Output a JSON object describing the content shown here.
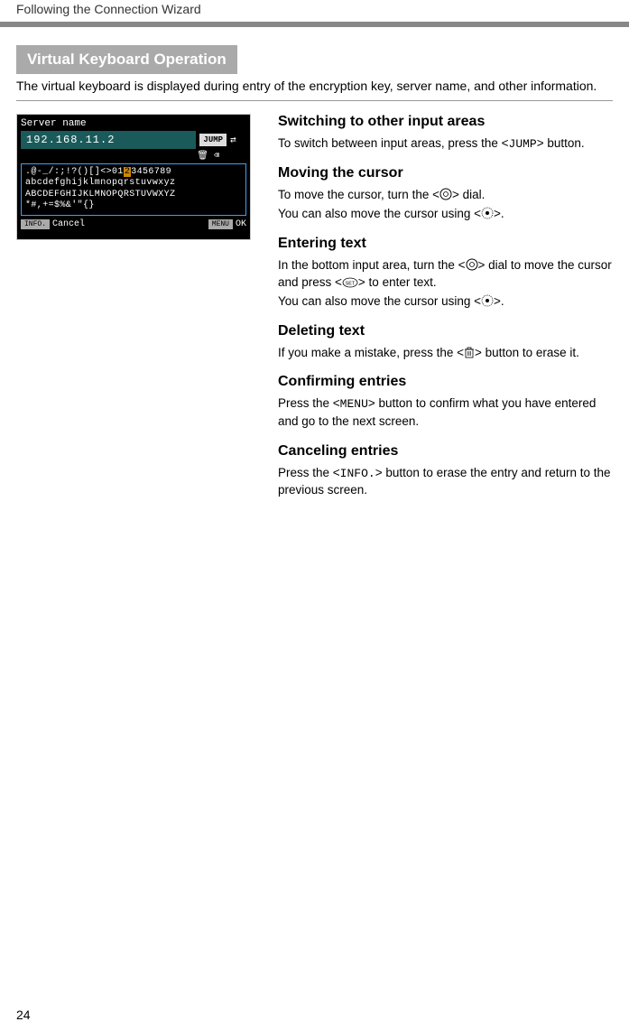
{
  "header": "Following the Connection Wizard",
  "section_title": "Virtual Keyboard Operation",
  "intro": "The virtual keyboard is displayed during entry of the encryption key, server name, and other information.",
  "camera": {
    "label": "Server name",
    "ip": "192.168.11.2",
    "jump": "JUMP",
    "grid1_a": ".@-_/:;!?()[]<>01",
    "grid1_hl": "2",
    "grid1_b": "3456789",
    "grid2": "abcdefghijklmnopqrstuvwxyz",
    "grid3": "ABCDEFGHIJKLMNOPQRSTUVWXYZ",
    "grid4": "*#,+=$%&'\"{}",
    "info": "INFO.",
    "cancel": "Cancel",
    "menu": "MENU",
    "ok": "OK"
  },
  "sections": {
    "switching": {
      "title": "Switching to other input areas",
      "p1a": "To switch between input areas, press the <",
      "jump": "JUMP",
      "p1b": "> button."
    },
    "moving": {
      "title": "Moving the cursor",
      "p1a": "To move the cursor, turn the <",
      "p1b": "> dial.",
      "p2a": "You can also move the cursor using <",
      "p2b": ">."
    },
    "entering": {
      "title": "Entering text",
      "p1a": "In the bottom input area, turn the <",
      "p1b": "> dial to move the cursor and press <",
      "p1c": "> to enter text.",
      "p2a": "You can also move the cursor using <",
      "p2b": ">."
    },
    "deleting": {
      "title": "Deleting text",
      "p1a": "If you make a mistake, press the <",
      "p1b": "> button to erase it."
    },
    "confirming": {
      "title": "Confirming entries",
      "p1a": "Press the <",
      "menu": "MENU",
      "p1b": "> button to confirm what you have entered and go to the next screen."
    },
    "canceling": {
      "title": "Canceling entries",
      "p1a": "Press the <",
      "info": "INFO.",
      "p1b": "> button to erase the entry and return to the previous screen."
    }
  },
  "page_number": "24"
}
